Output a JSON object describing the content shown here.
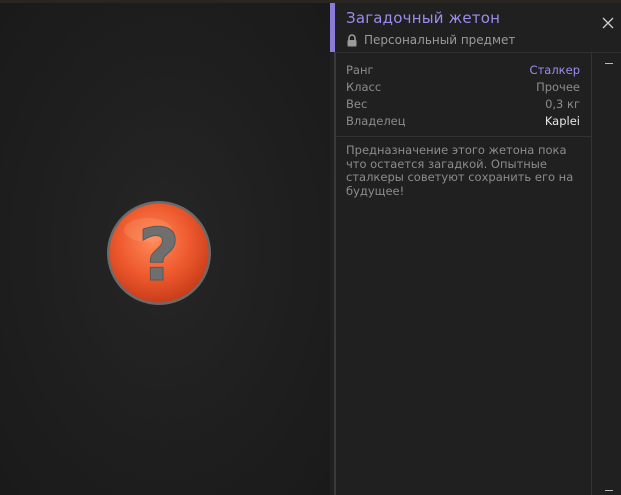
{
  "item": {
    "title": "Загадочный жетон",
    "subtitle": "Персональный предмет",
    "icon": "question-mark-token"
  },
  "stats": [
    {
      "label": "Ранг",
      "value": "Сталкер"
    },
    {
      "label": "Класс",
      "value": "Прочее"
    },
    {
      "label": "Вес",
      "value": "0,3 кг"
    },
    {
      "label": "Владелец",
      "value": "Kaplei"
    }
  ],
  "description": "Предназначение этого жетона пока что остается загадкой. Опытные сталкеры советуют сохранить его на будущее!",
  "colors": {
    "accent": "#9b8df0",
    "token": "#e8502a",
    "background": "#1b1b1b"
  }
}
